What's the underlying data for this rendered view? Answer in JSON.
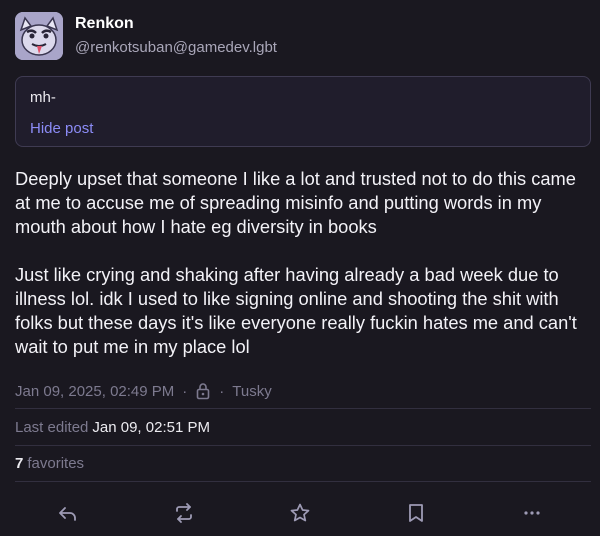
{
  "author": {
    "display_name": "Renkon",
    "handle": "@renkotsuban@gamedev.lgbt"
  },
  "content_warning": {
    "text": "mh-",
    "hide_label": "Hide post"
  },
  "post": {
    "paragraphs": [
      "Deeply upset that someone I like a lot and trusted not to do this came at me to accuse me of spreading misinfo and putting words in my mouth about how I hate eg diversity in books",
      "Just like crying and shaking after having already a bad week due to illness lol. idk I used to like signing online and shooting the shit with folks but these days it's like everyone really fuckin hates me and can't wait to put me in my place lol"
    ]
  },
  "meta": {
    "timestamp": "Jan 09, 2025, 02:49 PM",
    "separator": "·",
    "visibility_icon": "lock-icon",
    "client": "Tusky"
  },
  "edited": {
    "label": "Last edited",
    "date": "Jan 09, 02:51 PM"
  },
  "favorites": {
    "count": "7",
    "label": "favorites"
  },
  "actions": {
    "icons": [
      "reply-icon",
      "boost-icon",
      "favourite-icon",
      "bookmark-icon",
      "more-icon"
    ]
  },
  "colors": {
    "background": "#1a1820",
    "accent": "#8c8cf7",
    "muted": "#7d7a8f"
  }
}
